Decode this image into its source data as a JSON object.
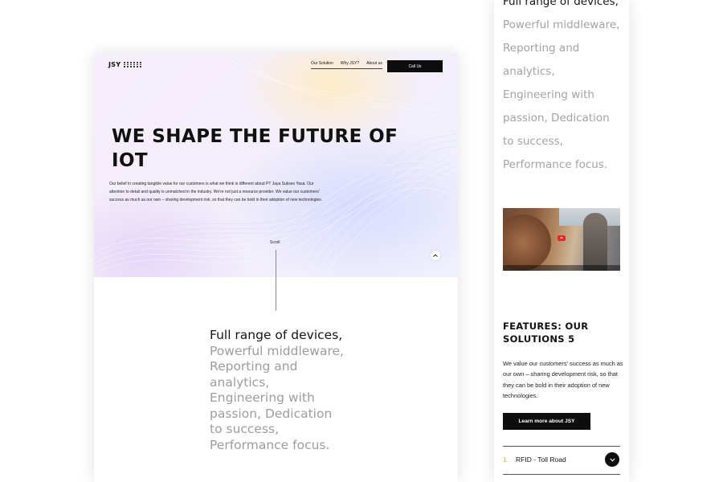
{
  "desktop": {
    "logo": {
      "text": "JSY"
    },
    "nav": {
      "items": [
        "Our Solution",
        "Why JSY?",
        "About us"
      ],
      "cta_label": "Call Us"
    },
    "hero": {
      "title": "WE SHAPE THE FUTURE OF IOT",
      "description": "Our belief in creating tangible value for our customers is what we think is different about PT Jaya Sukses Yasa. Our attention to detail and quality is unmatched in the industry. We're not just a resource provider. We value our customers' success as much as our own – sharing development risk, so that they can be bold in their adoption of new technologies.",
      "scroll_label": "Scroll"
    },
    "statement": {
      "highlight": "Full range of devices,",
      "rest": [
        "Powerful middleware,",
        "Reporting and",
        "analytics,",
        "Engineering with",
        "passion, Dedication",
        "to success,",
        "Performance focus."
      ]
    }
  },
  "mobile": {
    "statement": {
      "highlight": "Full range of devices,",
      "rest": [
        "Powerful middleware,",
        "Reporting and",
        "analytics,",
        "Engineering with",
        "passion, Dedication",
        "to success,",
        "Performance focus."
      ]
    },
    "features": {
      "title": "FEATURES: OUR SOLUTIONS 5",
      "description": "We value our customers' success as much as our own – sharing development risk, so that they can be bold in their adoption of new technologies.",
      "button_label": "Learn more about JSY"
    },
    "accordion": [
      {
        "number": "1.",
        "label": "RFID - Toll Road"
      }
    ]
  },
  "colors": {
    "accent": "#e0a93a",
    "dark": "#0d0d0d",
    "muted_text": "#9d9d9d"
  },
  "icons": [
    "logo-dots-icon",
    "chevron-up-icon",
    "play-icon",
    "chevron-down-icon"
  ]
}
